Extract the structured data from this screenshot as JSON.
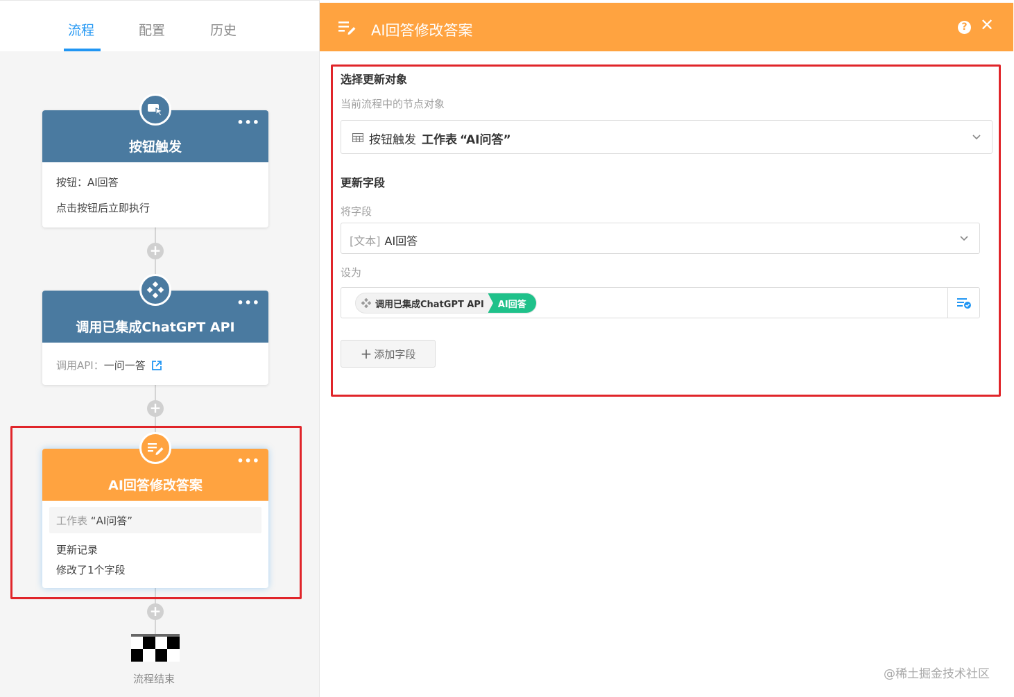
{
  "tabs": [
    {
      "label": "流程",
      "active": true
    },
    {
      "label": "配置",
      "active": false
    },
    {
      "label": "历史",
      "active": false
    }
  ],
  "nodes": {
    "trigger": {
      "title": "按钮触发",
      "line1": "按钮：AI回答",
      "line2": "点击按钮后立即执行",
      "icon": "button-trigger-icon"
    },
    "api": {
      "title": "调用已集成ChatGPT API",
      "label": "调用API：",
      "value": "一问一答",
      "icon": "api-integration-icon"
    },
    "update": {
      "title": "AI回答修改答案",
      "sheet_label": "工作表",
      "sheet_value": "“AI问答”",
      "line1": "更新记录",
      "line2": "修改了1个字段",
      "icon": "edit-record-icon"
    }
  },
  "finish": {
    "label": "流程结束"
  },
  "panel": {
    "title": "AI回答修改答案",
    "target_section": "选择更新对象",
    "target_label": "当前流程中的节点对象",
    "target_select": {
      "source": "按钮触发",
      "sheet": "工作表",
      "name": "“AI问答”"
    },
    "fields_section": "更新字段",
    "field_label": "将字段",
    "field_select": {
      "type": "[文本]",
      "name": "AI回答"
    },
    "set_label": "设为",
    "set_value": {
      "source": "调用已集成ChatGPT API",
      "field": "AI回答"
    },
    "add_field": "添加字段"
  },
  "watermark": "@稀土掘金技术社区",
  "colors": {
    "accent": "#2196f3",
    "node_blue": "#4a7aa0",
    "node_orange": "#ffa340",
    "tag_green": "#1fc18a",
    "highlight_red": "#e0252a"
  }
}
